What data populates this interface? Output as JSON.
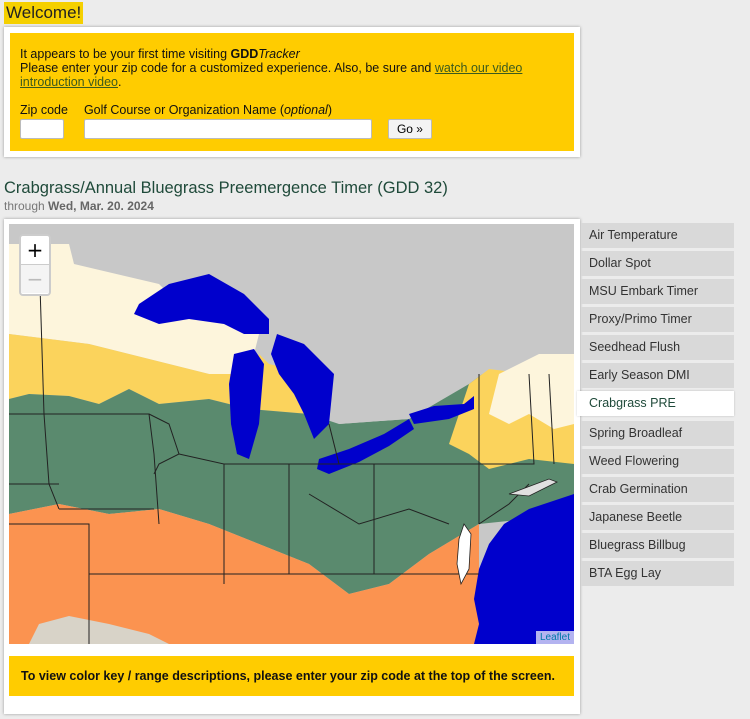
{
  "welcome": {
    "title": "Welcome!",
    "line1_prefix": "It appears to be your first time visiting ",
    "brand_bold": "GDD",
    "brand_italic": "Tracker",
    "line2": "Please enter your zip code for a customized experience. Also, be sure and ",
    "video_link": "watch our video introduction video",
    "line2_end": ".",
    "zip_label": "Zip code",
    "zip_value": "",
    "org_label": "Golf Course or Organization Name (",
    "org_label_optional": "optional",
    "org_label_end": ")",
    "org_value": "",
    "go_button": "Go »"
  },
  "section": {
    "title": "Crabgrass/Annual Bluegrass Preemergence Timer (GDD 32)",
    "through_label": "through ",
    "date": "Wed, Mar. 20. 2024"
  },
  "map": {
    "zoom_in": "+",
    "zoom_out": "−",
    "attribution": "Leaflet",
    "colors": {
      "background": "#c8c8c8",
      "water": "#0000cc",
      "cream": "#fdf5dc",
      "yellow": "#fbd35c",
      "green": "#5a8a6e",
      "orange": "#fb9350",
      "tan": "#d8d3c8"
    }
  },
  "key_note": "To view color key / range descriptions, please enter your zip code at the top of the screen.",
  "tabs": [
    {
      "label": "Air Temperature",
      "active": false
    },
    {
      "label": "Dollar Spot",
      "active": false
    },
    {
      "label": "MSU Embark Timer",
      "active": false
    },
    {
      "label": "Proxy/Primo Timer",
      "active": false
    },
    {
      "label": "Seedhead Flush",
      "active": false
    },
    {
      "label": "Early Season DMI",
      "active": false
    },
    {
      "label": "Crabgrass PRE",
      "active": true
    },
    {
      "label": "Spring Broadleaf",
      "active": false
    },
    {
      "label": "Weed Flowering",
      "active": false
    },
    {
      "label": "Crab Germination",
      "active": false
    },
    {
      "label": "Japanese Beetle",
      "active": false
    },
    {
      "label": "Bluegrass Billbug",
      "active": false
    },
    {
      "label": "BTA Egg Lay",
      "active": false
    }
  ]
}
